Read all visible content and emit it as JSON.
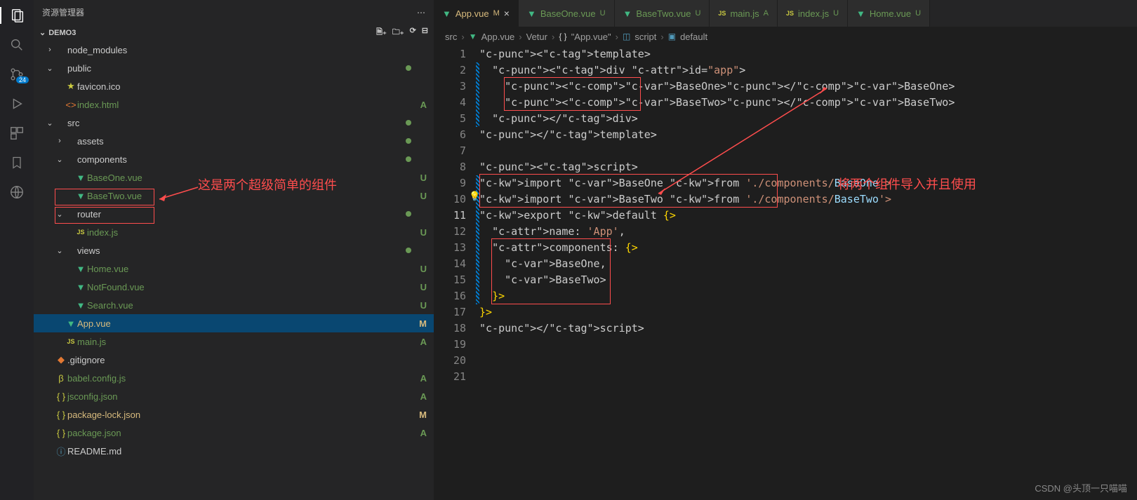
{
  "sidebar": {
    "title": "资源管理器",
    "section": "DEMO3",
    "badge": "24",
    "actions": [
      "new-file",
      "new-folder",
      "refresh",
      "collapse"
    ],
    "tree": [
      {
        "depth": 0,
        "chev": "›",
        "icon": "folder",
        "label": "node_modules",
        "status": "",
        "dot": ""
      },
      {
        "depth": 0,
        "chev": "⌄",
        "icon": "folder",
        "label": "public",
        "status": "",
        "dot": "green"
      },
      {
        "depth": 1,
        "chev": "",
        "icon": "star",
        "label": "favicon.ico",
        "status": "",
        "dot": ""
      },
      {
        "depth": 1,
        "chev": "",
        "icon": "html",
        "label": "index.html",
        "status": "A",
        "git": "a",
        "dot": ""
      },
      {
        "depth": 0,
        "chev": "⌄",
        "icon": "folder",
        "label": "src",
        "status": "",
        "dot": "green"
      },
      {
        "depth": 1,
        "chev": "›",
        "icon": "folder",
        "label": "assets",
        "status": "",
        "dot": "green"
      },
      {
        "depth": 1,
        "chev": "⌄",
        "icon": "folder",
        "label": "components",
        "status": "",
        "dot": "green"
      },
      {
        "depth": 2,
        "chev": "",
        "icon": "vue",
        "label": "BaseOne.vue",
        "status": "U",
        "git": "u",
        "dot": ""
      },
      {
        "depth": 2,
        "chev": "",
        "icon": "vue",
        "label": "BaseTwo.vue",
        "status": "U",
        "git": "u",
        "dot": ""
      },
      {
        "depth": 1,
        "chev": "⌄",
        "icon": "folder",
        "label": "router",
        "status": "",
        "dot": "green"
      },
      {
        "depth": 2,
        "chev": "",
        "icon": "js",
        "label": "index.js",
        "status": "U",
        "git": "u",
        "dot": ""
      },
      {
        "depth": 1,
        "chev": "⌄",
        "icon": "folder",
        "label": "views",
        "status": "",
        "dot": "green"
      },
      {
        "depth": 2,
        "chev": "",
        "icon": "vue",
        "label": "Home.vue",
        "status": "U",
        "git": "u",
        "dot": ""
      },
      {
        "depth": 2,
        "chev": "",
        "icon": "vue",
        "label": "NotFound.vue",
        "status": "U",
        "git": "u",
        "dot": ""
      },
      {
        "depth": 2,
        "chev": "",
        "icon": "vue",
        "label": "Search.vue",
        "status": "U",
        "git": "u",
        "dot": ""
      },
      {
        "depth": 1,
        "chev": "",
        "icon": "vue",
        "label": "App.vue",
        "status": "M",
        "git": "m",
        "selected": true,
        "dot": ""
      },
      {
        "depth": 1,
        "chev": "",
        "icon": "js",
        "label": "main.js",
        "status": "A",
        "git": "a",
        "dot": ""
      },
      {
        "depth": 0,
        "chev": "",
        "icon": "git",
        "label": ".gitignore",
        "status": "",
        "dot": ""
      },
      {
        "depth": 0,
        "chev": "",
        "icon": "babel",
        "label": "babel.config.js",
        "status": "A",
        "git": "a",
        "dot": ""
      },
      {
        "depth": 0,
        "chev": "",
        "icon": "braces",
        "label": "jsconfig.json",
        "status": "A",
        "git": "a",
        "dot": ""
      },
      {
        "depth": 0,
        "chev": "",
        "icon": "braces",
        "label": "package-lock.json",
        "status": "M",
        "git": "m",
        "dot": ""
      },
      {
        "depth": 0,
        "chev": "",
        "icon": "braces",
        "label": "package.json",
        "status": "A",
        "git": "a",
        "dot": ""
      },
      {
        "depth": 0,
        "chev": "",
        "icon": "info",
        "label": "README.md",
        "status": "",
        "dot": ""
      }
    ]
  },
  "tabs": [
    {
      "icon": "vue",
      "label": "App.vue",
      "status": "M",
      "git": "m",
      "active": true,
      "close": true
    },
    {
      "icon": "vue",
      "label": "BaseOne.vue",
      "status": "U",
      "git": "u"
    },
    {
      "icon": "vue",
      "label": "BaseTwo.vue",
      "status": "U",
      "git": "u"
    },
    {
      "icon": "js",
      "label": "main.js",
      "status": "A",
      "git": "a"
    },
    {
      "icon": "js",
      "label": "index.js",
      "status": "U",
      "git": "u"
    },
    {
      "icon": "vue",
      "label": "Home.vue",
      "status": "U",
      "git": "u"
    }
  ],
  "breadcrumb": {
    "parts": [
      "src",
      "App.vue",
      "Vetur",
      "\"App.vue\"",
      "script",
      "default"
    ],
    "icons": [
      "",
      "vue",
      "",
      "br",
      "cube",
      "bl"
    ]
  },
  "code": {
    "lines": [
      "<template>",
      "  <div id=\"app\">",
      "    <BaseOne></BaseOne>",
      "    <BaseTwo></BaseTwo>",
      "  </div>",
      "</template>",
      "",
      "<script>",
      "import BaseOne from './components/BaseOne'",
      "import BaseTwo from './components/BaseTwo'",
      "export default {",
      "  name: 'App',",
      "  components: {",
      "    BaseOne,",
      "    BaseTwo",
      "  }",
      "}",
      "</script>",
      "",
      "",
      ""
    ],
    "activeLine": 11
  },
  "annotations": {
    "left": "这是两个超级简单的组件",
    "right": "将两个组件导入并且使用"
  },
  "watermark": "CSDN @头顶一只喵喵"
}
